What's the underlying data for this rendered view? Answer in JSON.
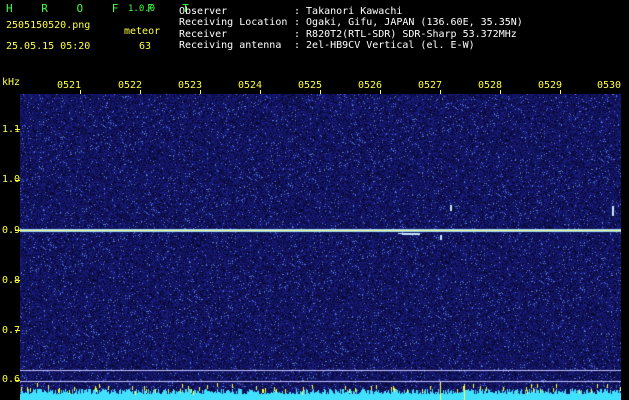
{
  "app": {
    "name": "H R O F F T",
    "version": "1.0.0",
    "filename": "2505150520.png",
    "datetime": "25.05.15 05:20",
    "meteor_label": "meteor",
    "meteor_count": "63"
  },
  "info": {
    "observer_label": "Observer",
    "observer_value": ": Takanori Kawachi",
    "location_label": "Receiving Location",
    "location_value": ": Ogaki, Gifu, JAPAN (136.60E, 35.35N)",
    "receiver_label": "Receiver",
    "receiver_value": ": R820T2(RTL-SDR) SDR-Sharp 53.372MHz",
    "antenna_label": "Receiving antenna",
    "antenna_value": ": 2el-HB9CV Vertical (el. E-W)"
  },
  "time_axis": [
    "0521",
    "0522",
    "0523",
    "0524",
    "0525",
    "0526",
    "0527",
    "0528",
    "0529",
    "0530"
  ],
  "freq_axis": {
    "unit": "kHz",
    "labels": [
      "1.1",
      "1.0",
      "0.9",
      "0.8",
      "0.7",
      "0.6"
    ]
  },
  "colors": {
    "background": "#000000",
    "label_yellow": "#ffff40",
    "brand_green": "#40ff40",
    "spectrum_noise": "#1a1a8c",
    "carrier_line": "#e8ff80",
    "floor_cyan": "#40e0ff"
  }
}
